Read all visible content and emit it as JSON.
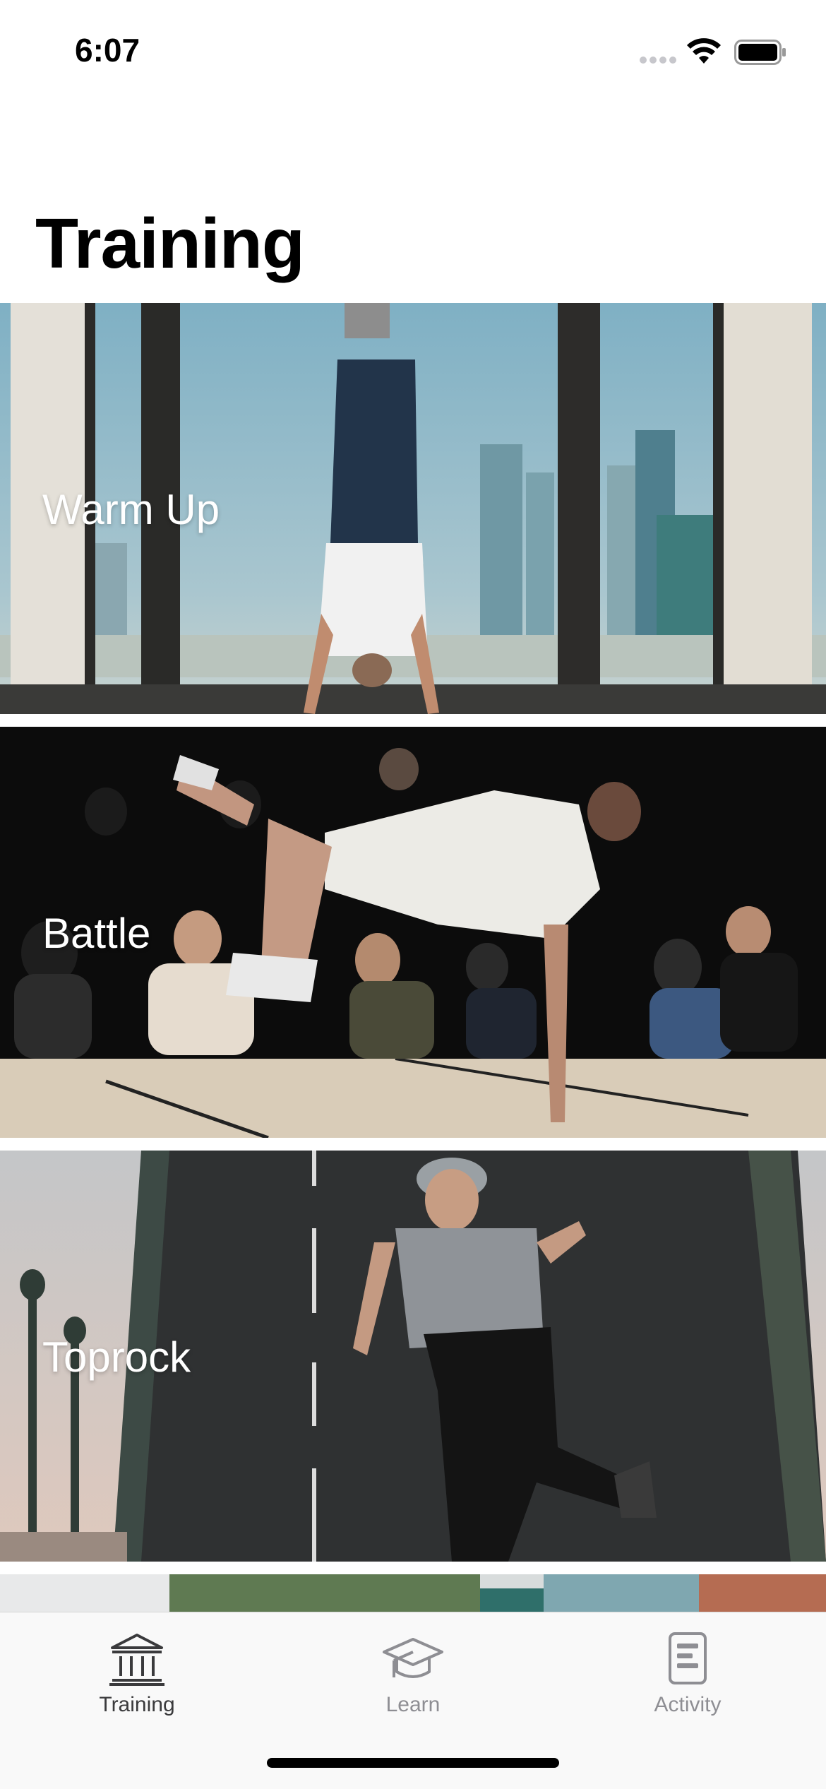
{
  "status_bar": {
    "time": "6:07"
  },
  "header": {
    "title": "Training"
  },
  "cards": [
    {
      "label": "Warm Up",
      "icon": "handstand-photo"
    },
    {
      "label": "Battle",
      "icon": "breakdance-battle-photo"
    },
    {
      "label": "Toprock",
      "icon": "toprock-dancer-photo"
    }
  ],
  "tab_bar": {
    "items": [
      {
        "label": "Training",
        "icon": "building-columns-icon",
        "selected": true
      },
      {
        "label": "Learn",
        "icon": "graduation-cap-icon",
        "selected": false
      },
      {
        "label": "Activity",
        "icon": "document-list-icon",
        "selected": false
      }
    ]
  },
  "colors": {
    "tab_selected": "#3a3a3c",
    "tab_unselected": "#8e8e93",
    "background": "#ffffff",
    "card_text": "#ffffff"
  }
}
